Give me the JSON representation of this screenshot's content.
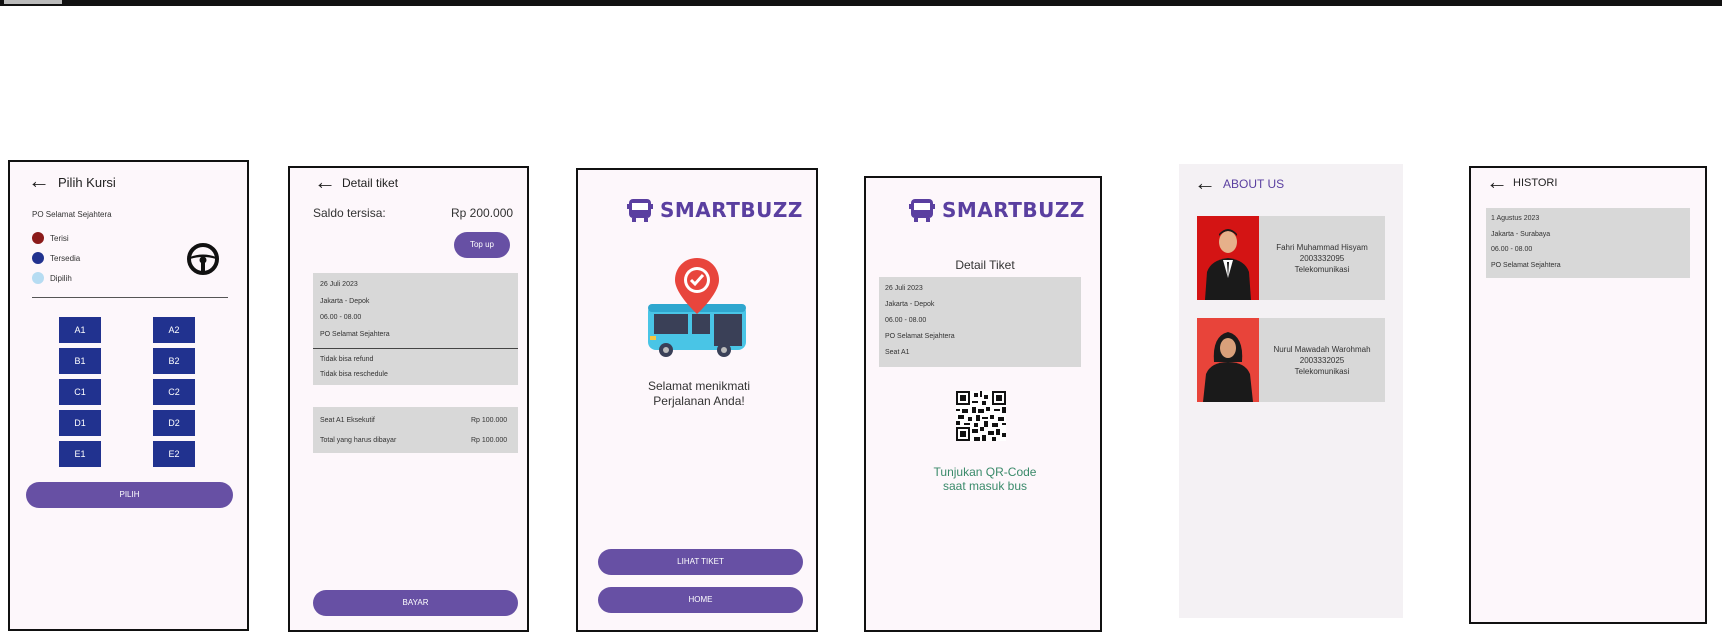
{
  "screen1": {
    "title": "Pilih Kursi",
    "operator": "PO Selamat Sejahtera",
    "legend": [
      {
        "label": "Terisi",
        "color": "#8b1a1a"
      },
      {
        "label": "Tersedia",
        "color": "#21328f"
      },
      {
        "label": "Dipilih",
        "color": "#b6dcf2"
      }
    ],
    "seats_left": [
      "A1",
      "B1",
      "C1",
      "D1",
      "E1"
    ],
    "seats_right": [
      "A2",
      "B2",
      "C2",
      "D2",
      "E2"
    ],
    "button": "PILIH",
    "icons": [
      "back-arrow-icon",
      "steering-wheel-icon"
    ]
  },
  "screen2": {
    "title": "Detail tiket",
    "saldo_label": "Saldo tersisa:",
    "saldo_value": "Rp 200.000",
    "topup": "Top up",
    "date": "26 Juli 2023",
    "route": "Jakarta - Depok",
    "time": "06.00 - 08.00",
    "operator": "PO Selamat Sejahtera",
    "note1": "Tidak bisa refund",
    "note2": "Tidak bisa reschedule",
    "item_label": "Seat A1 Eksekutif",
    "item_value": "Rp 100.000",
    "total_label": "Total yang harus dibayar",
    "total_value": "Rp 100.000",
    "button": "BAYAR"
  },
  "screen3": {
    "logo": "SMARTBUZZ",
    "message_line1": "Selamat menikmati",
    "message_line2": "Perjalanan Anda!",
    "button_ticket": "LIHAT TIKET",
    "button_home": "HOME"
  },
  "screen4": {
    "logo": "SMARTBUZZ",
    "title": "Detail Tiket",
    "date": "26 Juli 2023",
    "route": "Jakarta - Depok",
    "time": "06.00 - 08.00",
    "operator": "PO Selamat Sejahtera",
    "seat": "Seat A1",
    "qr_line1": "Tunjukan QR-Code",
    "qr_line2": "saat masuk bus"
  },
  "screen5": {
    "title": "ABOUT US",
    "members": [
      {
        "name": "Fahri Muhammad Hisyam",
        "nim": "2003332095",
        "dept": "Telekomunikasi",
        "bg": "#d41414"
      },
      {
        "name": "Nurul Mawadah Warohmah",
        "nim": "2003332025",
        "dept": "Telekomunikasi",
        "bg": "#e8443a"
      }
    ]
  },
  "screen6": {
    "title": "HISTORI",
    "date": "1 Agustus 2023",
    "route": "Jakarta - Surabaya",
    "time": "06.00 - 08.00",
    "operator": "PO Selamat Sejahtera"
  },
  "colors": {
    "primary": "#6750a4",
    "seat": "#21328f",
    "panel_gray": "#d8d8d8",
    "qr_text": "#3a8a6a",
    "logo": "#5a3fa0"
  }
}
